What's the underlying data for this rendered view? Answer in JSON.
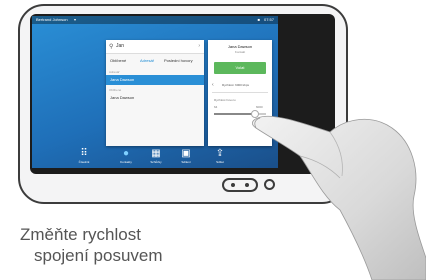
{
  "status": {
    "user": "Bertrand Johnson",
    "time": "07:57"
  },
  "search": {
    "query": "Jan"
  },
  "contacts": {
    "tabs": [
      "Oblíbené",
      "Adresář",
      "Poslední hovory"
    ],
    "active_tab": "Adresář",
    "section_labels": [
      "Adresář",
      "Oblíbené"
    ],
    "rows": [
      "Jana Dawson",
      "Jana Dawson"
    ]
  },
  "call_card": {
    "name": "Jana Dawson",
    "subtitle": "Kontakt",
    "call_label": "Volat",
    "number": "Rychlost: 6000 kbps",
    "rate_left": "Rychlost hovoru",
    "rate_min": "64",
    "rate_max": "6000",
    "rate_fraction": 0.78
  },
  "toolbar": {
    "items": [
      {
        "icon": "keypad-icon",
        "label": "Číselník"
      },
      {
        "icon": "contacts-icon",
        "label": "Kontakty"
      },
      {
        "icon": "calendar-icon",
        "label": "Schůzky"
      },
      {
        "icon": "video-icon",
        "label": "Sdílení"
      },
      {
        "icon": "share-icon",
        "label": "Sdílet"
      }
    ]
  },
  "caption": {
    "line1": "Změňte rychlost",
    "line2": "spojení posuvem"
  },
  "colors": {
    "screen_blue": "#2a8fd6",
    "call_green": "#5cb85c",
    "selected_row": "#2a8fd6"
  }
}
